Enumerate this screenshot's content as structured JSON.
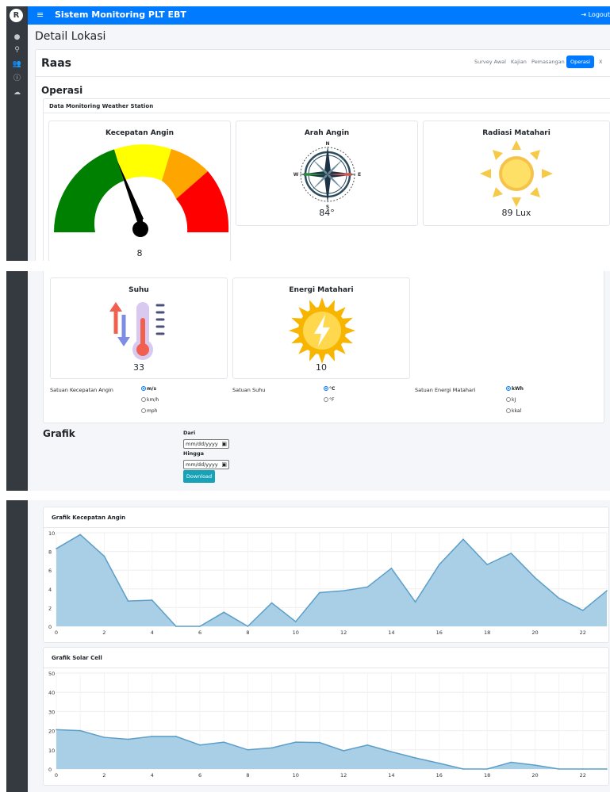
{
  "app": {
    "brand": "Sistem Monitoring PLT EBT",
    "logo_letter": "R",
    "logout": "Logout"
  },
  "sidebar_icons": [
    "dashboard-icon",
    "map-marker-icon",
    "users-icon",
    "info-icon",
    "cloud-upload-icon"
  ],
  "page": {
    "title": "Detail Lokasi",
    "location": "Raas",
    "section": "Operasi",
    "subsection": "Data Monitoring Weather Station"
  },
  "tabs": [
    "Survey Awal",
    "Kajian",
    "Pemasangan",
    "Operasi",
    "X"
  ],
  "widgets": {
    "wind_speed": {
      "title": "Kecepatan Angin",
      "value": "8"
    },
    "wind_dir": {
      "title": "Arah Angin",
      "value": "84°",
      "compass": {
        "n": "N",
        "e": "E",
        "s": "S",
        "w": "W"
      }
    },
    "radiation": {
      "title": "Radiasi Matahari",
      "value": "89 Lux"
    },
    "temperature": {
      "title": "Suhu",
      "value": "33"
    },
    "solar_energy": {
      "title": "Energi Matahari",
      "value": "10"
    }
  },
  "units": {
    "wind": {
      "label": "Satuan Kecepatan Angin",
      "options": [
        "m/s",
        "km/h",
        "mph"
      ],
      "selected": "m/s"
    },
    "temp": {
      "label": "Satuan Suhu",
      "options": [
        "°C",
        "°F"
      ],
      "selected": "°C"
    },
    "energy": {
      "label": "Satuan Energi Matahari",
      "options": [
        "kWh",
        "kJ",
        "kkal"
      ],
      "selected": "kWh"
    }
  },
  "grafik": {
    "title": "Grafik",
    "from_label": "Dari",
    "to_label": "Hingga",
    "date_placeholder": "mm/dd/yyyy",
    "download": "Download"
  },
  "colors": {
    "primary": "#007bff",
    "sidebar": "#343a40",
    "area_fill": "#a9cfe6",
    "area_line": "#5b9ec9",
    "download": "#17a2b8"
  },
  "chart_data": [
    {
      "type": "area",
      "title": "Grafik Kecepatan Angin",
      "x": [
        0,
        1,
        2,
        3,
        4,
        5,
        6,
        7,
        8,
        9,
        10,
        11,
        12,
        13,
        14,
        15,
        16,
        17,
        18,
        19,
        20,
        21,
        22,
        23
      ],
      "values": [
        8.3,
        9.8,
        7.5,
        2.7,
        2.8,
        0,
        0,
        1.5,
        0,
        2.5,
        0.5,
        3.6,
        3.8,
        4.2,
        6.2,
        2.6,
        6.6,
        9.3,
        6.6,
        7.8,
        5.2,
        3,
        1.7,
        3.8
      ],
      "ylim": [
        0,
        10
      ],
      "yticks": [
        "0",
        "2",
        "4",
        "6",
        "8",
        "10"
      ],
      "xticks": [
        "0",
        "2",
        "4",
        "6",
        "8",
        "10",
        "12",
        "14",
        "16",
        "18",
        "20",
        "22"
      ],
      "grid": true
    },
    {
      "type": "area",
      "title": "Grafik Solar Cell",
      "x": [
        0,
        1,
        2,
        3,
        4,
        5,
        6,
        7,
        8,
        9,
        10,
        11,
        12,
        13,
        14,
        15,
        16,
        17,
        18,
        19,
        20,
        21,
        22,
        23
      ],
      "values": [
        20.5,
        20,
        16.5,
        15.5,
        17,
        17,
        12.5,
        14,
        10,
        11,
        14,
        13.8,
        9.5,
        12.5,
        9,
        5.8,
        3,
        0,
        0,
        3.5,
        2,
        0,
        0,
        0
      ],
      "ylim": [
        0,
        50
      ],
      "yticks": [
        "0",
        "10",
        "20",
        "30",
        "40",
        "50"
      ],
      "xticks": [
        "0",
        "2",
        "4",
        "6",
        "8",
        "10",
        "12",
        "14",
        "16",
        "18",
        "20",
        "22"
      ],
      "grid": true
    }
  ]
}
